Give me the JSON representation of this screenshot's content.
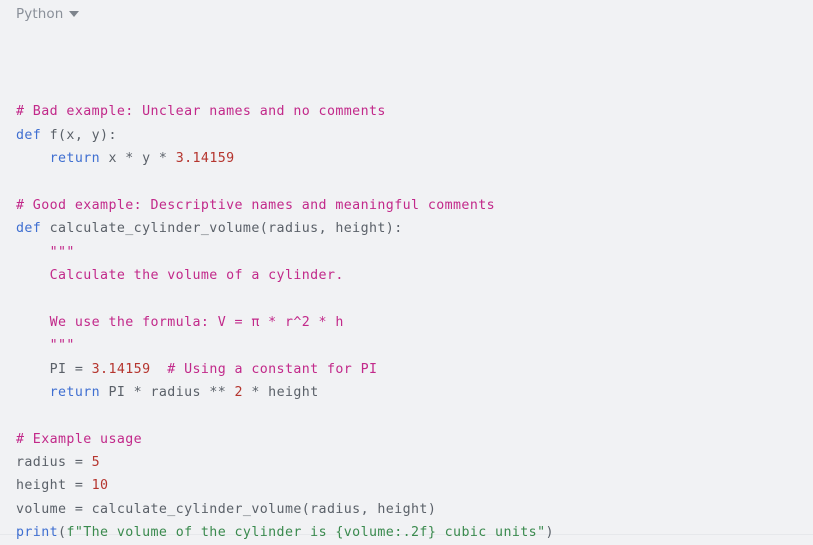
{
  "header": {
    "language_label": "Python",
    "dropdown_icon": "chevron-down-icon"
  },
  "colors": {
    "background": "#f1f2f4",
    "comment": "#c2298a",
    "string": "#c2298a",
    "fstring": "#3a8a4e",
    "keyword": "#3f6fd1",
    "builtin": "#3f6fd1",
    "number": "#b5352e",
    "plain": "#5b6169",
    "header_text": "#8a9099"
  },
  "code": {
    "language": "python",
    "lines": [
      {
        "id": 1,
        "tokens": [
          {
            "t": "# Bad example: Unclear names and no comments",
            "c": "tok-com"
          }
        ]
      },
      {
        "id": 2,
        "tokens": [
          {
            "t": "def",
            "c": "tok-kw"
          },
          {
            "t": " f(x, y):",
            "c": "tok-plain"
          }
        ]
      },
      {
        "id": 3,
        "tokens": [
          {
            "t": "    ",
            "c": "tok-plain"
          },
          {
            "t": "return",
            "c": "tok-kw"
          },
          {
            "t": " x * y * ",
            "c": "tok-plain"
          },
          {
            "t": "3.14159",
            "c": "tok-num"
          }
        ]
      },
      {
        "id": 4,
        "tokens": [
          {
            "t": "",
            "c": "tok-plain"
          }
        ]
      },
      {
        "id": 5,
        "tokens": [
          {
            "t": "# Good example: Descriptive names and meaningful comments",
            "c": "tok-com"
          }
        ]
      },
      {
        "id": 6,
        "tokens": [
          {
            "t": "def",
            "c": "tok-kw"
          },
          {
            "t": " calculate_cylinder_volume(radius, height):",
            "c": "tok-plain"
          }
        ]
      },
      {
        "id": 7,
        "tokens": [
          {
            "t": "    \"\"\"",
            "c": "tok-str"
          }
        ]
      },
      {
        "id": 8,
        "tokens": [
          {
            "t": "    Calculate the volume of a cylinder.",
            "c": "tok-str"
          }
        ]
      },
      {
        "id": 9,
        "tokens": [
          {
            "t": "",
            "c": "tok-str"
          }
        ]
      },
      {
        "id": 10,
        "tokens": [
          {
            "t": "    We use the formula: V = π * r^2 * h",
            "c": "tok-str"
          }
        ]
      },
      {
        "id": 11,
        "tokens": [
          {
            "t": "    \"\"\"",
            "c": "tok-str"
          }
        ]
      },
      {
        "id": 12,
        "tokens": [
          {
            "t": "    PI = ",
            "c": "tok-plain"
          },
          {
            "t": "3.14159",
            "c": "tok-num"
          },
          {
            "t": "  ",
            "c": "tok-plain"
          },
          {
            "t": "# Using a constant for PI",
            "c": "tok-com"
          }
        ]
      },
      {
        "id": 13,
        "tokens": [
          {
            "t": "    ",
            "c": "tok-plain"
          },
          {
            "t": "return",
            "c": "tok-kw"
          },
          {
            "t": " PI * radius ** ",
            "c": "tok-plain"
          },
          {
            "t": "2",
            "c": "tok-num"
          },
          {
            "t": " * height",
            "c": "tok-plain"
          }
        ]
      },
      {
        "id": 14,
        "tokens": [
          {
            "t": "",
            "c": "tok-plain"
          }
        ]
      },
      {
        "id": 15,
        "tokens": [
          {
            "t": "# Example usage",
            "c": "tok-com"
          }
        ]
      },
      {
        "id": 16,
        "tokens": [
          {
            "t": "radius = ",
            "c": "tok-plain"
          },
          {
            "t": "5",
            "c": "tok-num"
          }
        ]
      },
      {
        "id": 17,
        "tokens": [
          {
            "t": "height = ",
            "c": "tok-plain"
          },
          {
            "t": "10",
            "c": "tok-num"
          }
        ]
      },
      {
        "id": 18,
        "tokens": [
          {
            "t": "volume = calculate_cylinder_volume(radius, height)",
            "c": "tok-plain"
          }
        ]
      },
      {
        "id": 19,
        "tokens": [
          {
            "t": "print",
            "c": "tok-bi"
          },
          {
            "t": "(",
            "c": "tok-plain"
          },
          {
            "t": "f\"The volume of the cylinder is {volume:.2f} cubic units\"",
            "c": "tok-fstr"
          },
          {
            "t": ")",
            "c": "tok-plain"
          }
        ]
      }
    ]
  }
}
